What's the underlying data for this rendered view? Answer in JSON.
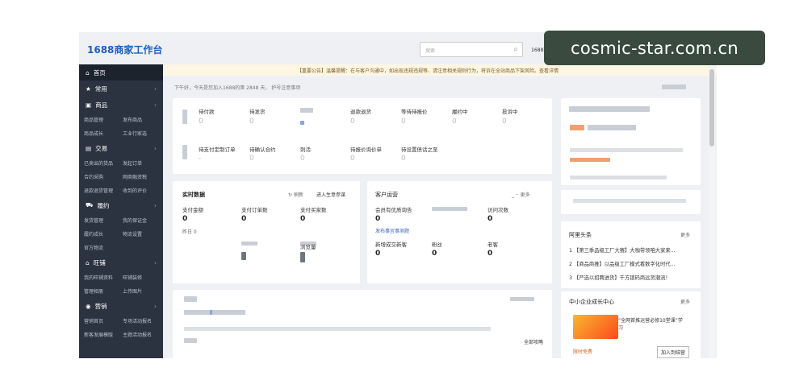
{
  "header": {
    "logo": "1688商家工作台",
    "search_placeholder": "搜索",
    "user": "1688商"
  },
  "watermark": "cosmic-star.com.cn",
  "notice": "【重要公告】温馨提醒：在与客户沟通中，如出现违规违规等、请注意相关规则行为，将诉在全站商品下架风险。查看详情",
  "greeting": "下午好，今天是您加入1688的第 2848 天，",
  "greeting_extra": "护号注意事项",
  "sidebar": {
    "home": "首页",
    "sections": [
      {
        "title": "常用",
        "items": []
      },
      {
        "title": "商品",
        "items": [
          [
            "商品管理",
            "发布商品"
          ],
          [
            "商品成长",
            "工业行家选"
          ]
        ]
      },
      {
        "title": "交易",
        "items": [
          [
            "已卖出的货品",
            "发起订单"
          ],
          [
            "合约采购",
            "网商融资税"
          ],
          [
            "退款退货管理",
            "收到的评价"
          ]
        ]
      },
      {
        "title": "履约",
        "items": [
          [
            "发货管理",
            "我的保证金"
          ],
          [
            "履约成长",
            "物流设置"
          ],
          [
            "官方物流",
            ""
          ]
        ]
      },
      {
        "title": "旺铺",
        "items": [
          [
            "我的旺铺资料",
            "旺铺装修"
          ],
          [
            "管理相册",
            "上传图片"
          ]
        ]
      },
      {
        "title": "营销",
        "items": [
          [
            "营销首页",
            "专场活动报名"
          ],
          [
            "新客发展模版",
            "主题活动报名"
          ]
        ]
      }
    ]
  },
  "orders": {
    "row1": [
      {
        "label": "待付款",
        "value": "0"
      },
      {
        "label": "待发货",
        "value": "0"
      },
      {
        "label": "",
        "value": ""
      },
      {
        "label": "退款退货",
        "value": "0"
      },
      {
        "label": "等待待报价",
        "value": "0"
      },
      {
        "label": "履约中",
        "value": "0"
      },
      {
        "label": "投诉中",
        "value": "0"
      }
    ],
    "row2": [
      {
        "label": "待支付定制订单",
        "value": "-"
      },
      {
        "label": "待确认合约",
        "value": "0"
      },
      {
        "label": "刺活",
        "value": "0"
      },
      {
        "label": "待报价询价单",
        "value": "0"
      },
      {
        "label": "待设置债话之至",
        "value": "0"
      }
    ]
  },
  "realtime": {
    "title": "实时数据",
    "refresh": "刷新",
    "link": "进入生意参谋",
    "items": [
      {
        "label": "支付金额",
        "value": "0",
        "sub": "昨日 0"
      },
      {
        "label": "支付订单数",
        "value": "0",
        "sub": ""
      },
      {
        "label": "支付买家数",
        "value": "0",
        "sub": ""
      },
      {
        "label": "",
        "value": "",
        "sub": ""
      },
      {
        "label": "",
        "value": "",
        "sub": ""
      },
      {
        "label": "浏览量",
        "value": "",
        "sub": ""
      }
    ]
  },
  "customer": {
    "title": "客户运营",
    "items": [
      {
        "label": "会员有优质询告",
        "value": "0"
      },
      {
        "label": "",
        "value": ""
      },
      {
        "label": "访问次数",
        "value": "0"
      },
      {
        "label": "新增成交新客",
        "value": "0"
      },
      {
        "label": "粉丝",
        "value": "0"
      },
      {
        "label": "老客",
        "value": "0"
      }
    ],
    "sub1": "发布事宜事测题",
    "more": "更多"
  },
  "bottom_card": {
    "more": "全部攻略"
  },
  "headlines": {
    "title": "阿里头条",
    "more": "更多",
    "items": [
      {
        "n": "1",
        "text": "【第三季品级工厂大赛】大咖带领咱大家来..."
      },
      {
        "n": "2",
        "text": "【商品商推】以品级工厂模式看数字化时代..."
      },
      {
        "n": "3",
        "text": "【严选以招聘进货】千方锁码商远货潮流！"
      }
    ]
  },
  "growth": {
    "title": "中小企业成长中心",
    "more": "更多",
    "banner_text": "“全网首推运营必修10堂课”学习",
    "free": "限时免费",
    "btn": "加入到结营"
  }
}
